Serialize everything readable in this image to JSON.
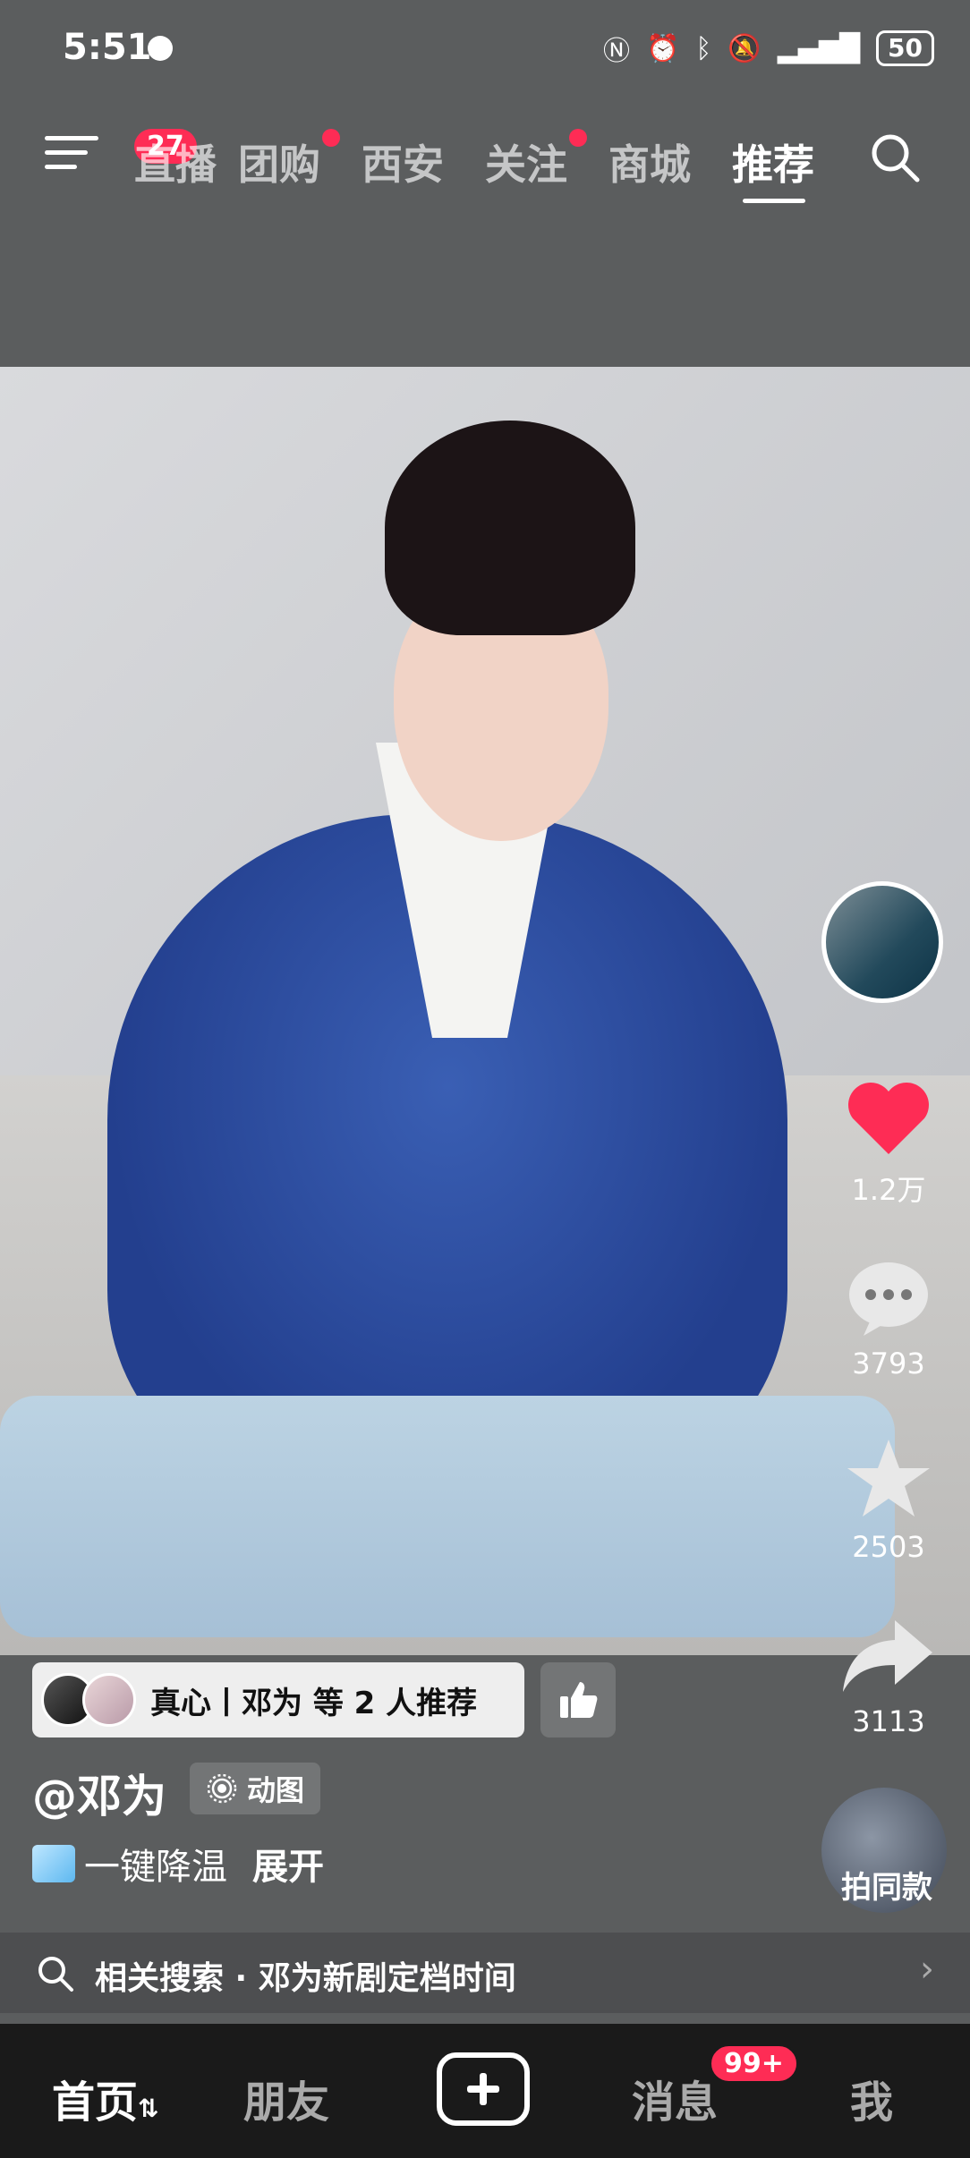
{
  "status_bar": {
    "time": "5:51",
    "battery": "50"
  },
  "top_nav": {
    "menu_badge": "27",
    "tabs": [
      {
        "label": "直播"
      },
      {
        "label": "团购"
      },
      {
        "label": "西安"
      },
      {
        "label": "关注"
      },
      {
        "label": "商城"
      },
      {
        "label": "推荐"
      }
    ]
  },
  "video": {
    "like_count": "1.2万",
    "comment_count": "3793",
    "favorite_count": "2503",
    "share_count": "3113",
    "same_style_label": "拍同款",
    "recommend_text": "真心丨邓为 等 2 人推荐",
    "author": "@邓为",
    "motion_tag": "动图",
    "caption": "一键降温",
    "expand_label": "展开",
    "related_search": "相关搜索 · 邓为新剧定档时间"
  },
  "bottom_nav": {
    "home": "首页",
    "friends": "朋友",
    "messages": "消息",
    "messages_badge": "99+",
    "me": "我"
  },
  "colors": {
    "accent": "#fe2c55",
    "nav_bg": "#1a1a1a",
    "top_bg": "#5b5d5e"
  }
}
